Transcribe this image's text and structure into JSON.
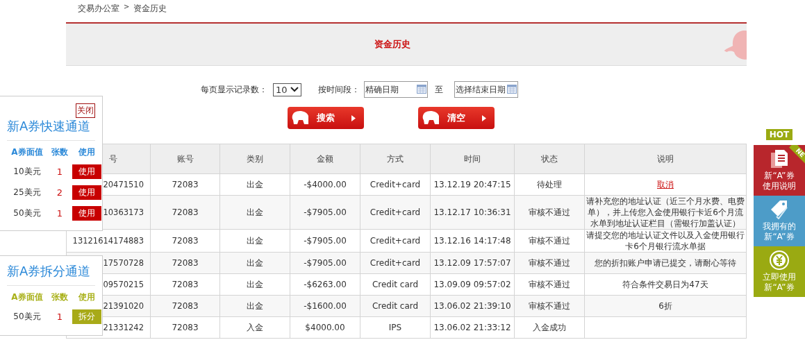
{
  "breadcrumb": {
    "items": [
      "交易办公室",
      "资金历史"
    ],
    "separator": ">"
  },
  "header": {
    "title": "资金历史"
  },
  "filters": {
    "page_size_label": "每页显示记录数：",
    "page_size_value": "10",
    "period_label": "按时间段：",
    "start_date": {
      "placeholder": "精确日期"
    },
    "to_label": "至",
    "end_date": {
      "placeholder": "选择结束日期"
    }
  },
  "buttons": [
    {
      "label": "搜索"
    },
    {
      "label": "清空"
    }
  ],
  "table": {
    "columns": [
      "号",
      "账号",
      "类别",
      "金额",
      "方式",
      "时间",
      "状态",
      "说明"
    ],
    "rows": [
      {
        "cells": [
          "20471510",
          "72083",
          "出金",
          "-$4000.00",
          "Credit+card",
          "13.12.19 20:47:15",
          "待处理"
        ],
        "note": {
          "kind": "link",
          "text": "取消"
        }
      },
      {
        "cells": [
          "10363173",
          "72083",
          "出金",
          "-$7905.00",
          "Credit+card",
          "13.12.17 10:36:31",
          "审核不通过"
        ],
        "note": {
          "kind": "text",
          "text": "请补充您的地址认证（近三个月水费、电费单），并上传您入金使用银行卡近6个月流水单到地址认证栏目（需银行加盖认证）"
        }
      },
      {
        "cells": [
          "13121614174883",
          "72083",
          "出金",
          "-$7905.00",
          "Credit+card",
          "13.12.16 14:17:48",
          "审核不通过"
        ],
        "note": {
          "kind": "text",
          "text": "请提交您的地址认证文件以及入金使用银行卡6个月银行流水单据"
        }
      },
      {
        "cells": [
          "17570728",
          "72083",
          "出金",
          "-$7905.00",
          "Credit+card",
          "13.12.09 17:57:07",
          "审核不通过"
        ],
        "note": {
          "kind": "text",
          "text": "您的折扣账户申请已提交，请耐心等待"
        }
      },
      {
        "cells": [
          "09570215",
          "72083",
          "出金",
          "-$6263.00",
          "Credit card",
          "13.09.09 09:57:02",
          "审核不通过"
        ],
        "note": {
          "kind": "text",
          "text": "符合条件交易日为47天"
        }
      },
      {
        "cells": [
          "21391020",
          "72083",
          "出金",
          "-$1600.00",
          "Credit card",
          "13.06.02 21:39:10",
          "审核不通过"
        ],
        "note": {
          "kind": "text",
          "text": "6折"
        }
      },
      {
        "cells": [
          "21331242",
          "72083",
          "入金",
          "$4000.00",
          "IPS",
          "13.06.02 21:33:12",
          "入金成功"
        ]
      }
    ]
  },
  "voucher_panels": [
    {
      "kind": "use",
      "close_label": "关闭",
      "title": "新A券快速通道",
      "columns": [
        "A券面值",
        "张数",
        "使用"
      ],
      "rows": [
        {
          "value": "10美元",
          "count": "1",
          "action": "使用"
        },
        {
          "value": "25美元",
          "count": "2",
          "action": "使用"
        },
        {
          "value": "50美元",
          "count": "1",
          "action": "使用"
        }
      ]
    },
    {
      "kind": "split",
      "title": "新A券拆分通道",
      "columns": [
        "A券面值",
        "张数",
        "使用"
      ],
      "rows": [
        {
          "value": "50美元",
          "count": "1",
          "action": "拆分"
        }
      ]
    }
  ],
  "side_menu": {
    "badge": "HOT",
    "ribbon": "NE",
    "items": [
      {
        "color": "#b8262c",
        "lines": [
          "新“A”券",
          "使用说明"
        ]
      },
      {
        "color": "#4d9cc8",
        "lines": [
          "我拥有的",
          "新“A”券"
        ]
      },
      {
        "color": "#9aaa12",
        "lines": [
          "立即使用",
          "新“A”券"
        ]
      }
    ]
  }
}
